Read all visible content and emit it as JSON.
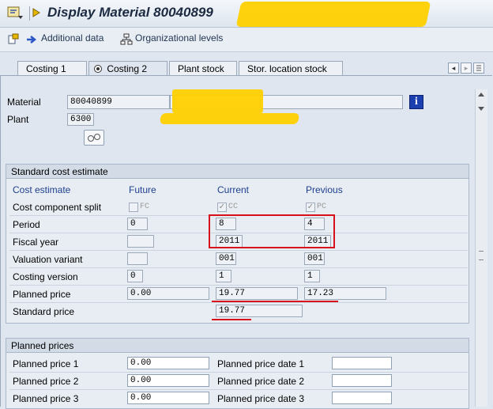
{
  "window": {
    "title": "Display Material 80040899"
  },
  "toolbar": {
    "additional_data": "Additional data",
    "org_levels": "Organizational levels"
  },
  "tabs": [
    {
      "label": "Costing 1"
    },
    {
      "label": "Costing 2"
    },
    {
      "label": "Plant stock"
    },
    {
      "label": "Stor. location stock"
    }
  ],
  "header": {
    "material_label": "Material",
    "material_value": "80040899",
    "plant_label": "Plant",
    "plant_value": "6300"
  },
  "standard_cost": {
    "title": "Standard cost estimate",
    "columns": {
      "cost_estimate": "Cost estimate",
      "future": "Future",
      "current": "Current",
      "previous": "Previous"
    },
    "component_split": {
      "label": "Cost component split",
      "future": "FC",
      "current": "CC",
      "previous": "PC"
    },
    "period": {
      "label": "Period",
      "future": "0",
      "current": "8",
      "previous": "4"
    },
    "fiscal_year": {
      "label": "Fiscal year",
      "future": "",
      "current": "2011",
      "previous": "2011"
    },
    "valuation_variant": {
      "label": "Valuation variant",
      "future": "",
      "current": "001",
      "previous": "001"
    },
    "costing_version": {
      "label": "Costing version",
      "future": "0",
      "current": "1",
      "previous": "1"
    },
    "planned_price": {
      "label": "Planned price",
      "future": "0.00",
      "current": "19.77",
      "previous": "17.23"
    },
    "standard_price": {
      "label": "Standard price",
      "current": "19.77"
    }
  },
  "planned_prices": {
    "title": "Planned prices",
    "rows": [
      {
        "label": "Planned price 1",
        "value": "0.00",
        "date_label": "Planned price date 1",
        "date_value": ""
      },
      {
        "label": "Planned price 2",
        "value": "0.00",
        "date_label": "Planned price date 2",
        "date_value": ""
      },
      {
        "label": "Planned price 3",
        "value": "0.00",
        "date_label": "Planned price date 3",
        "date_value": ""
      }
    ]
  }
}
